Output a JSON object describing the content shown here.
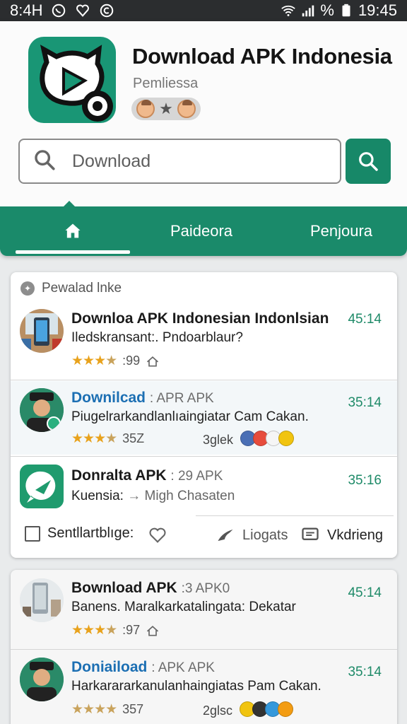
{
  "status_bar": {
    "time_left": "8:4H",
    "battery_pct": "%",
    "time_right": "19:45"
  },
  "app": {
    "title": "Download APK Indonesia",
    "subtitle": "Pemliessa"
  },
  "search": {
    "placeholder": "Download"
  },
  "tabs": [
    {
      "label": "home",
      "icon": "home-icon",
      "active": true
    },
    {
      "label": "Paideora"
    },
    {
      "label": "Penjoura"
    }
  ],
  "section": {
    "heading": "Pewalad lnke"
  },
  "items": [
    {
      "title": "Downloa APK Indonesian Indonlsian",
      "desc": "Iledskransant:. Pndoarblaur?",
      "time": "45:14",
      "rating": ":99",
      "stars": 3.5
    },
    {
      "title_accent": "Downilcad",
      "title_tag": ": APR APK",
      "desc": "Piugelrarkandlanlıaingiatar Cam Cakan.",
      "time": "35:14",
      "rating": "35Z",
      "extra": "3glek",
      "stars": 3.5
    },
    {
      "title": "Donralta APK",
      "title_tag": ": 29 APK",
      "desc_prefix": "Kuensia:",
      "desc_suffix": "Migh Chasaten",
      "time": "35:16"
    }
  ],
  "actions": {
    "checkbox_label": "Sentllartblıge:",
    "share_label": "Liogats",
    "comment_label": "Vkdrieng"
  },
  "items2": [
    {
      "title": "Bownload APK",
      "title_tag": ":3 APK0",
      "desc": "Banens. Maralkarkatalingata: Dekatar",
      "time": "45:14",
      "rating": ":97",
      "stars": 3.5
    },
    {
      "title_accent": "Doniaiload",
      "title_tag": ": APK APK",
      "desc": "Harkarararkanulanhaingiatas Pam Cakan.",
      "time": "35:14",
      "rating": "357",
      "extra": "2glsc",
      "stars": 3.5
    }
  ],
  "colors": {
    "primary": "#1a8a6a",
    "accent_blue": "#1c6fb3",
    "star": "#e8a21c",
    "time": "#1e8a68"
  }
}
